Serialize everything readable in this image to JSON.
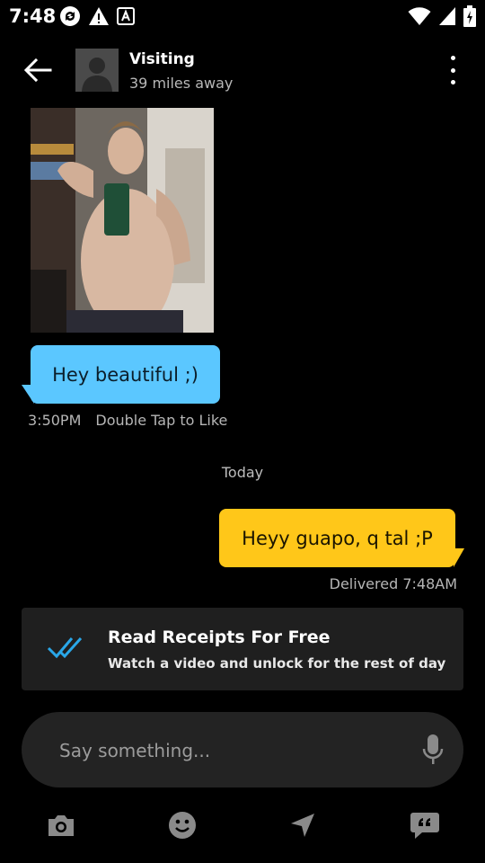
{
  "status_bar": {
    "time": "7:48",
    "icons": [
      "sync-icon",
      "warning-icon",
      "app-notification-icon",
      "wifi-icon",
      "cell-signal-icon",
      "battery-charging-icon"
    ]
  },
  "header": {
    "back_icon": "arrow-left-icon",
    "name": "Visiting",
    "distance": "39 miles away",
    "menu_icon": "more-vertical-icon"
  },
  "messages": [
    {
      "type": "photo",
      "direction": "incoming"
    },
    {
      "type": "text",
      "direction": "incoming",
      "text": "Hey beautiful ;)",
      "time": "3:50PM",
      "action": "Double Tap to Like",
      "color": "#5bc7ff"
    },
    {
      "type": "date_separator",
      "text": "Today"
    },
    {
      "type": "text",
      "direction": "outgoing",
      "text": "Heyy guapo, q tal ;P",
      "status": "Delivered 7:48AM",
      "color": "#ffc719"
    }
  ],
  "receipts_promo": {
    "icon": "double-check-icon",
    "title": "Read Receipts For Free",
    "subtitle": "Watch a video and unlock for the rest of day"
  },
  "composer": {
    "placeholder": "Say something...",
    "value": "",
    "mic_icon": "microphone-icon"
  },
  "toolbar": {
    "items": [
      {
        "icon": "camera-icon"
      },
      {
        "icon": "emoji-icon"
      },
      {
        "icon": "location-arrow-icon"
      },
      {
        "icon": "quick-replies-icon"
      }
    ]
  },
  "colors": {
    "incoming_bubble": "#5bc7ff",
    "outgoing_bubble": "#ffc719",
    "background": "#000000",
    "card": "#1f1f1f",
    "input": "#232323",
    "accent_check": "#2aa7e8"
  }
}
